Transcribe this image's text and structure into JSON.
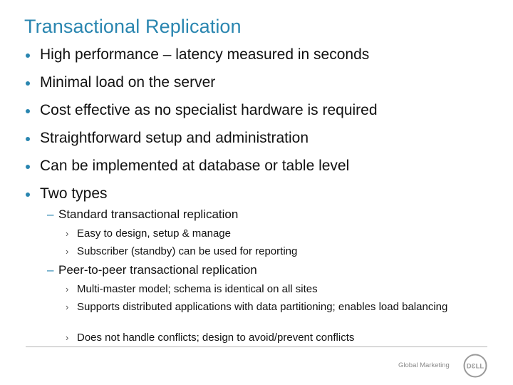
{
  "slide": {
    "title": "Transactional Replication",
    "bullets": [
      "High performance – latency measured in seconds",
      "Minimal load on the server",
      "Cost effective as no specialist hardware is required",
      "Straightforward setup and administration",
      "Can be implemented at database or table level",
      "Two types"
    ],
    "types": [
      {
        "label": "Standard transactional replication",
        "items": [
          "Easy to design, setup & manage",
          "Subscriber (standby) can be used for reporting"
        ]
      },
      {
        "label": "Peer-to-peer transactional replication",
        "items": [
          "Multi-master model; schema is identical on all sites",
          "Supports distributed applications with data partitioning; enables load balancing",
          "Does not handle conflicts; design to avoid/prevent conflicts"
        ]
      }
    ],
    "glyphs": {
      "dash": "–",
      "chevron": "›"
    }
  },
  "footer": {
    "text": "Global Marketing",
    "logo_text": "DƐLL"
  },
  "colors": {
    "accent": "#2a86b0",
    "body_text": "#111111",
    "footer_text": "#8a8a8a"
  }
}
